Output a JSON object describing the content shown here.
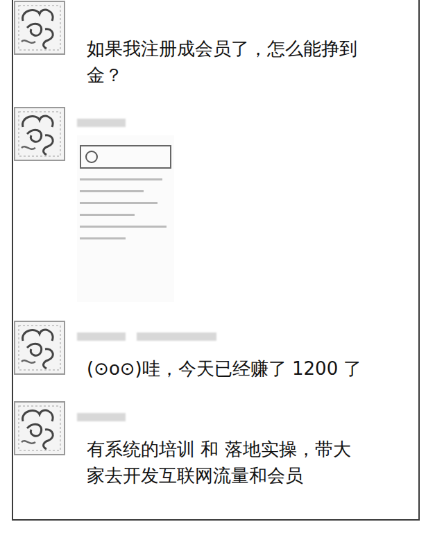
{
  "messages": [
    {
      "kind": "text",
      "name_bars": 0,
      "text": "如果我注册成会员了，怎么能挣到金？"
    },
    {
      "kind": "image",
      "name_bars": 1,
      "text": ""
    },
    {
      "kind": "text",
      "name_bars": 2,
      "text": "(⊙o⊙)哇，今天已经赚了 1200 了"
    },
    {
      "kind": "text",
      "name_bars": 1,
      "text": "有系统的培训 和 落地实操，带大家去开发互联网流量和会员"
    }
  ]
}
